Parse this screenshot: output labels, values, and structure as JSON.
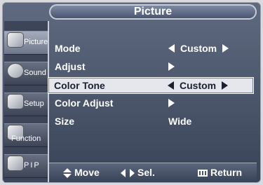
{
  "title": "Picture",
  "sidebar": {
    "items": [
      {
        "label": "Picture",
        "icon": "picture-icon",
        "active": true
      },
      {
        "label": "Sound",
        "icon": "sound-icon",
        "active": false
      },
      {
        "label": "Setup",
        "icon": "setup-icon",
        "active": false
      },
      {
        "label": "Function",
        "icon": "function-icon",
        "active": false
      },
      {
        "label": "PIP",
        "icon": "pip-icon",
        "active": false
      }
    ]
  },
  "menu": {
    "rows": [
      {
        "label": "Mode",
        "value": "Custom",
        "left_arrow": true,
        "right_arrow": true,
        "selected": false
      },
      {
        "label": "Adjust",
        "value": "",
        "left_arrow": false,
        "right_arrow": true,
        "selected": false
      },
      {
        "label": "Color Tone",
        "value": "Custom",
        "left_arrow": true,
        "right_arrow": true,
        "selected": true
      },
      {
        "label": "Color Adjust",
        "value": "",
        "left_arrow": false,
        "right_arrow": true,
        "selected": false
      },
      {
        "label": "Size",
        "value": "Wide",
        "left_arrow": false,
        "right_arrow": false,
        "selected": false
      }
    ]
  },
  "bottom_bar": {
    "move_label": "Move",
    "select_label": "Sel.",
    "return_label": "Return"
  }
}
